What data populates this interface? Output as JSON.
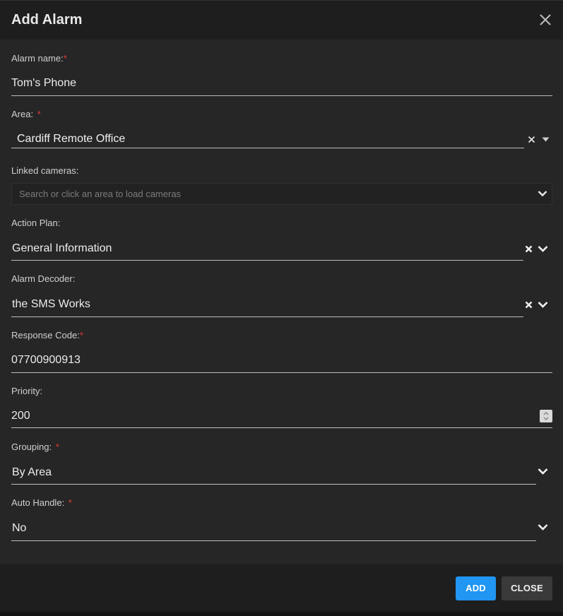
{
  "dialog": {
    "title": "Add Alarm"
  },
  "fields": {
    "alarm_name": {
      "label": "Alarm name:",
      "required_mark": "*",
      "value": "Tom's Phone"
    },
    "area": {
      "label": "Area:",
      "required_mark": "*",
      "value": "Cardiff Remote Office"
    },
    "linked_cameras": {
      "label": "Linked cameras:",
      "placeholder": "Search or click an area to load cameras"
    },
    "action_plan": {
      "label": "Action Plan:",
      "value": "General Information"
    },
    "alarm_decoder": {
      "label": "Alarm Decoder:",
      "value": "the SMS Works"
    },
    "response_code": {
      "label": "Response Code:",
      "required_mark": "*",
      "value": "07700900913"
    },
    "priority": {
      "label": "Priority:",
      "value": "200"
    },
    "grouping": {
      "label": "Grouping:",
      "required_mark": "*",
      "value": "By Area"
    },
    "auto_handle": {
      "label": "Auto Handle:",
      "required_mark": "*",
      "value": "No"
    }
  },
  "footer": {
    "add_label": "ADD",
    "close_label": "CLOSE"
  },
  "colors": {
    "primary": "#2196f3",
    "required": "#e53935",
    "background": "#262626",
    "header": "#1e1e1e"
  }
}
